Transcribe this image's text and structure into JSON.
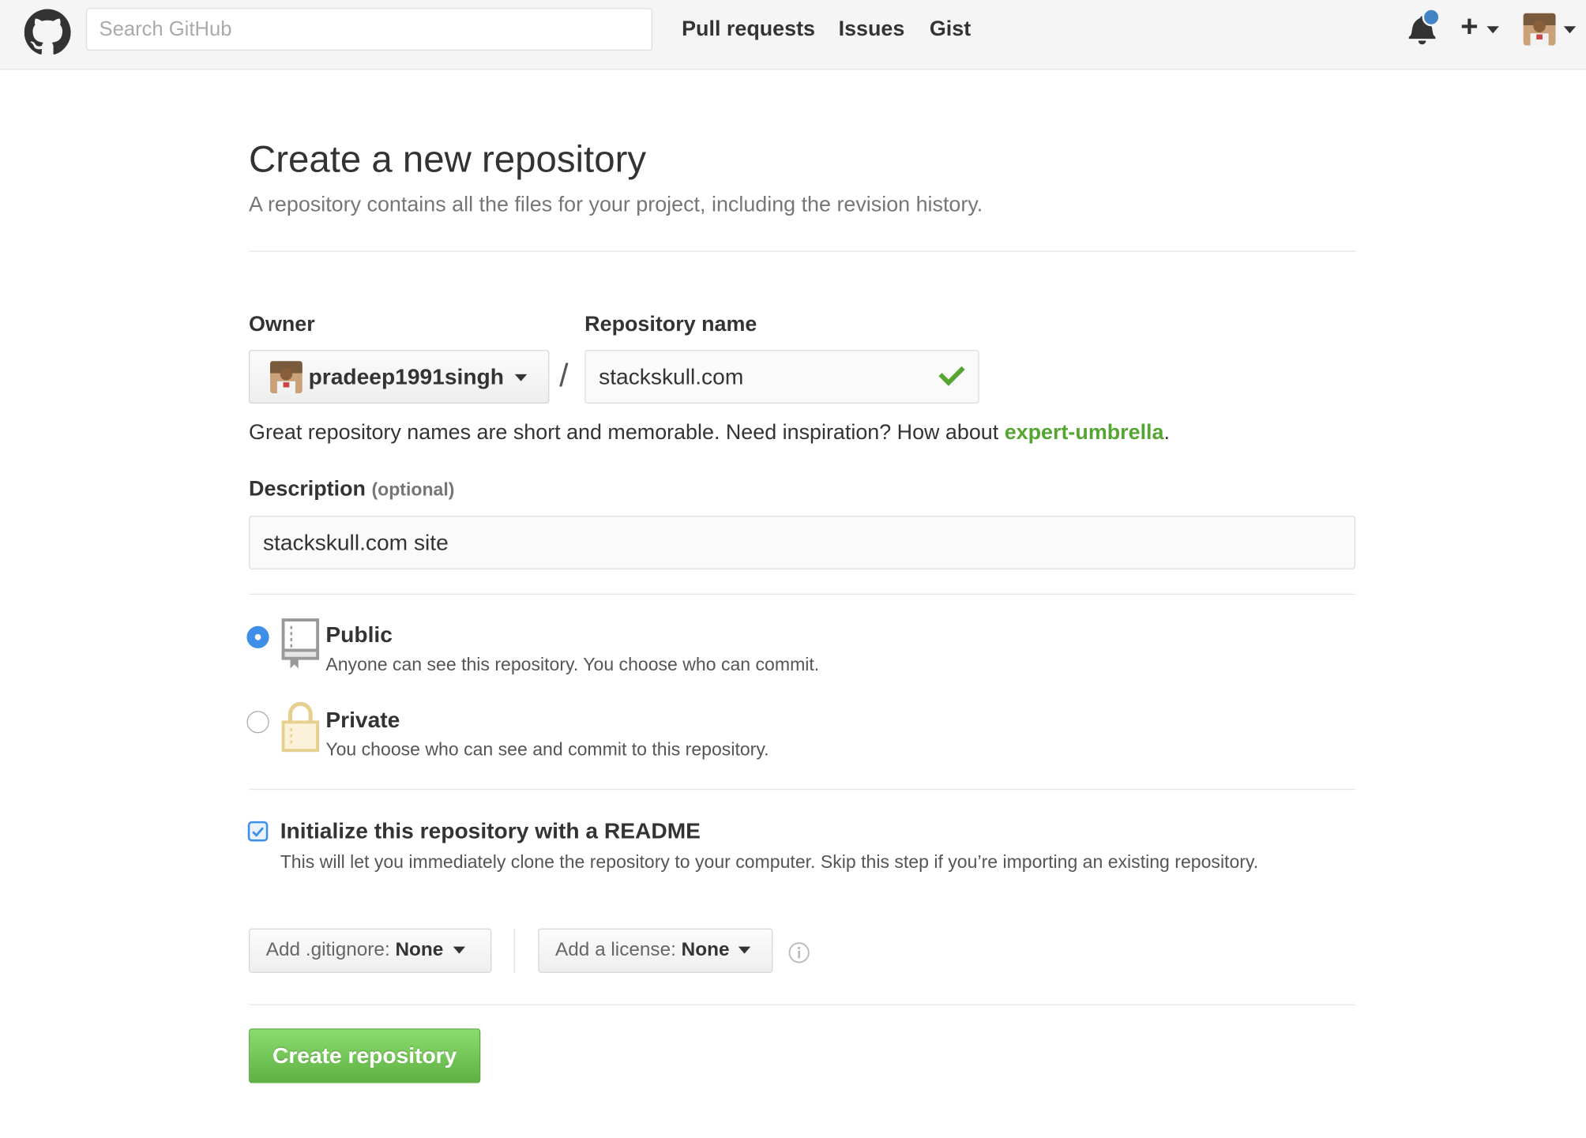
{
  "header": {
    "search_placeholder": "Search GitHub",
    "nav": [
      "Pull requests",
      "Issues",
      "Gist"
    ],
    "icons": {
      "logo": "github-octocat-icon",
      "notifications": "bell-icon",
      "new": "plus-icon",
      "avatar": "user-avatar"
    }
  },
  "page": {
    "title": "Create a new repository",
    "subtitle": "A repository contains all the files for your project, including the revision history."
  },
  "form": {
    "owner_label": "Owner",
    "owner_value": "pradeep1991singh",
    "separator": "/",
    "repo_name_label": "Repository name",
    "repo_name_value": "stackskull.com",
    "hint_text": "Great repository names are short and memorable. Need inspiration? How about ",
    "hint_suggestion": "expert-umbrella",
    "hint_end": ".",
    "description_label": "Description",
    "description_optional": "(optional)",
    "description_value": "stackskull.com site",
    "visibility": [
      {
        "title": "Public",
        "desc": "Anyone can see this repository. You choose who can commit.",
        "selected": true
      },
      {
        "title": "Private",
        "desc": "You choose who can see and commit to this repository.",
        "selected": false
      }
    ],
    "readme_title": "Initialize this repository with a README",
    "readme_desc": "This will let you immediately clone the repository to your computer. Skip this step if you’re importing an existing repository.",
    "readme_checked": true,
    "gitignore_label": "Add .gitignore:",
    "gitignore_value": "None",
    "license_label": "Add a license:",
    "license_value": "None",
    "submit_label": "Create repository"
  },
  "colors": {
    "accent_blue": "#3d8fe8",
    "success_green": "#55a532",
    "button_green": "#60b044",
    "lock_yellow": "#e6cf8f"
  }
}
